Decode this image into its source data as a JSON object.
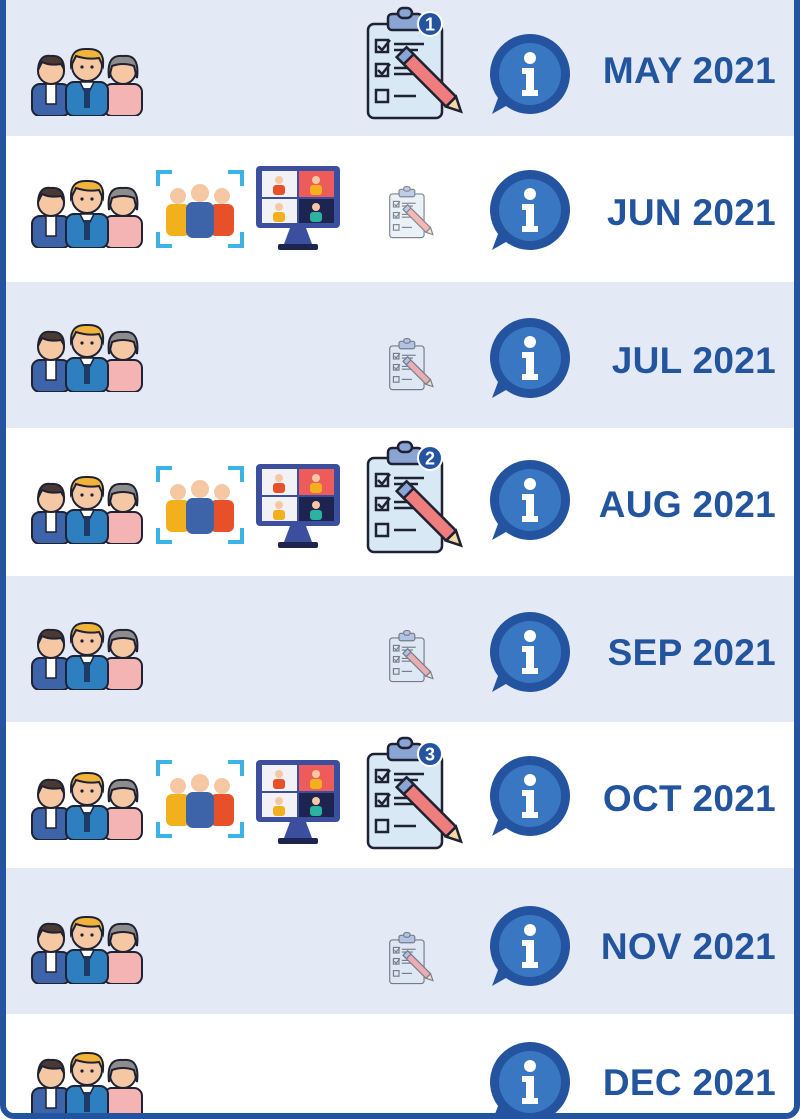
{
  "colors": {
    "accent": "#24549f",
    "text": "#23559e",
    "row_shaded": "#e4e9f6",
    "row_plain": "#ffffff",
    "timeline": "#d2d2d2"
  },
  "icons": {
    "team": "team-icon",
    "meeting": "group-meeting-icon",
    "video_call": "video-conference-icon",
    "task": "checklist-icon",
    "info": "info-icon"
  },
  "timeline": [
    {
      "month": "MAY 2021",
      "meeting": false,
      "task": "big",
      "badge": "1"
    },
    {
      "month": "JUN 2021",
      "meeting": true,
      "task": "small",
      "badge": ""
    },
    {
      "month": "JUL 2021",
      "meeting": false,
      "task": "small",
      "badge": ""
    },
    {
      "month": "AUG 2021",
      "meeting": true,
      "task": "big",
      "badge": "2"
    },
    {
      "month": "SEP 2021",
      "meeting": false,
      "task": "small",
      "badge": ""
    },
    {
      "month": "OCT 2021",
      "meeting": true,
      "task": "big",
      "badge": "3"
    },
    {
      "month": "NOV 2021",
      "meeting": false,
      "task": "small",
      "badge": ""
    },
    {
      "month": "DEC 2021",
      "meeting": false,
      "task": "none",
      "badge": ""
    }
  ]
}
